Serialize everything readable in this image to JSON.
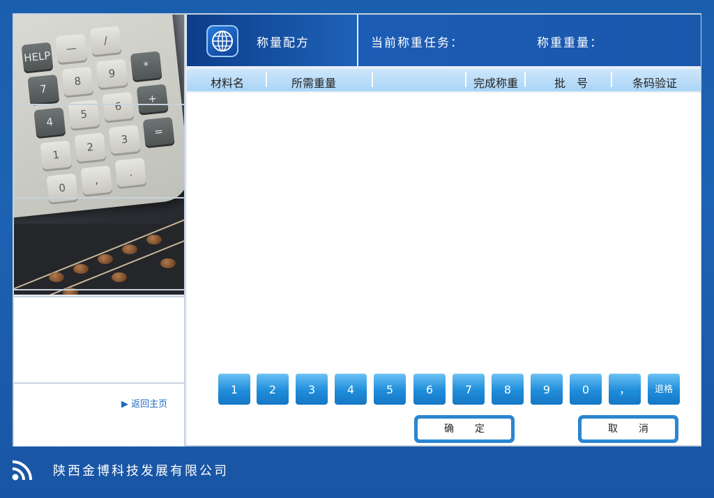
{
  "header": {
    "recipe_title": "称量配方",
    "task_label": "当前称重任务：",
    "weight_label": "称重重量："
  },
  "columns": [
    "材料名",
    "所需重量",
    "",
    "完成称重",
    "批　号",
    "条码验证"
  ],
  "keypad": [
    "1",
    "2",
    "3",
    "4",
    "5",
    "6",
    "7",
    "8",
    "9",
    "0",
    "，",
    "退格"
  ],
  "actions": {
    "confirm": "确定",
    "cancel": "取消"
  },
  "sidebar": {
    "back_home": "返回主页"
  },
  "footer": {
    "company": "陕西金博科技发展有限公司"
  },
  "photo_keys": [
    "HELP",
    "—",
    "/",
    "7",
    "8",
    "9",
    "*",
    "4",
    "5",
    "6",
    "+",
    "1",
    "2",
    "3",
    "=",
    "0",
    ",",
    "."
  ],
  "colors": {
    "accent": "#1f8ddb",
    "header_dark": "#0c3d8a",
    "column_header": "#a9d4f6"
  }
}
